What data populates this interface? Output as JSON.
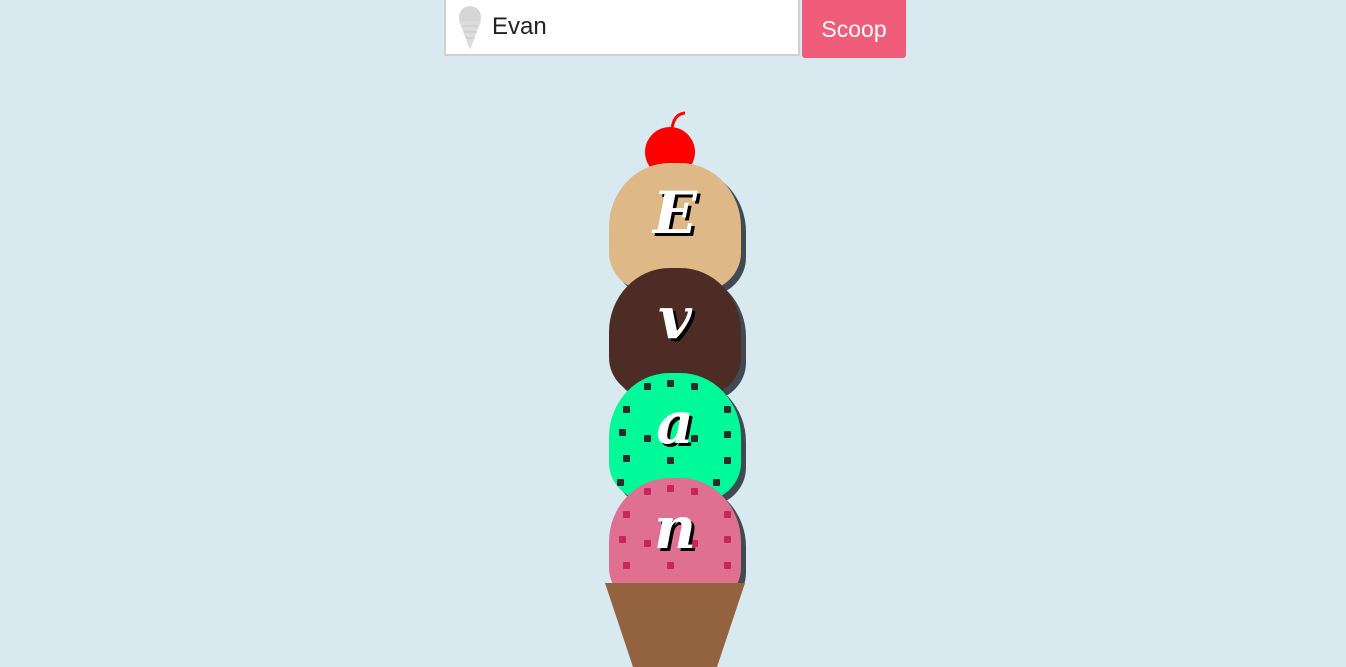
{
  "form": {
    "name_value": "Evan",
    "button_label": "Scoop"
  },
  "cherry_color": "#ff0000",
  "scoops": [
    {
      "letter": "E",
      "flavor": "vanilla",
      "color": "#deb887",
      "sprinkle_color": ""
    },
    {
      "letter": "v",
      "flavor": "chocolate",
      "color": "#4e2c26",
      "sprinkle_color": ""
    },
    {
      "letter": "a",
      "flavor": "mint-chip",
      "color": "#00fa9a",
      "sprinkle_color": "#2b2b2b"
    },
    {
      "letter": "n",
      "flavor": "strawberry",
      "color": "#df7091",
      "sprinkle_color": "#c8265a"
    }
  ],
  "cone_color": "#93623e",
  "colors": {
    "background": "#d9e9f0",
    "button": "#ef5d7a"
  }
}
